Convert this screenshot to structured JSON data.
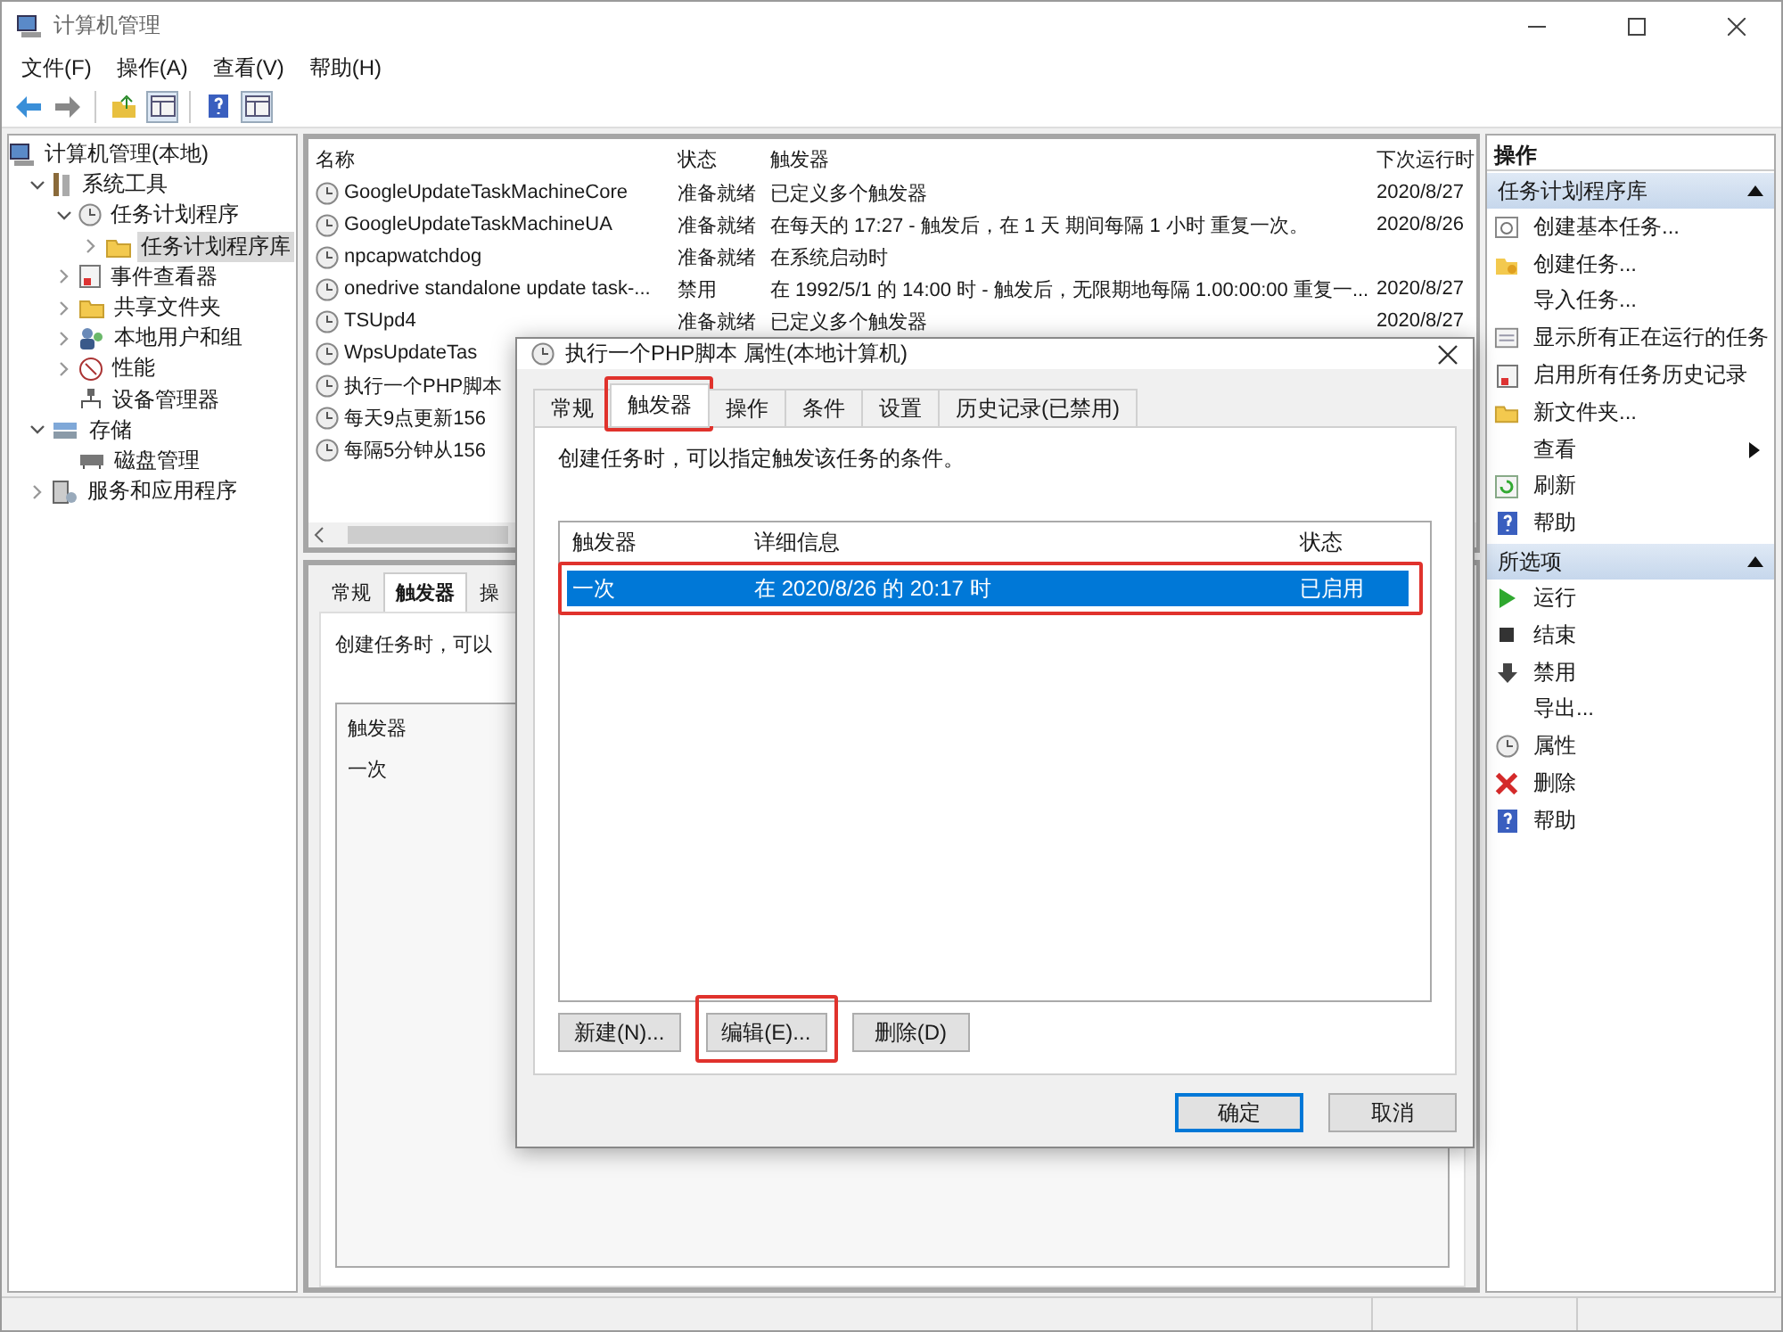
{
  "window": {
    "title": "计算机管理"
  },
  "menu": [
    "文件(F)",
    "操作(A)",
    "查看(V)",
    "帮助(H)"
  ],
  "tree": [
    {
      "label": "计算机管理(本地)",
      "selected": false,
      "children": [
        {
          "label": "系统工具",
          "expanded": true,
          "selected": false,
          "children": [
            {
              "label": "任务计划程序",
              "expanded": true,
              "selected": false,
              "children": [
                {
                  "label": "任务计划程序库",
                  "expanded": false,
                  "selected": true
                }
              ]
            },
            {
              "label": "事件查看器",
              "expanded": false,
              "selected": false
            },
            {
              "label": "共享文件夹",
              "expanded": false,
              "selected": false
            },
            {
              "label": "本地用户和组",
              "expanded": false,
              "selected": false
            },
            {
              "label": "性能",
              "expanded": false,
              "selected": false
            },
            {
              "label": "设备管理器",
              "selected": false
            }
          ]
        },
        {
          "label": "存储",
          "expanded": true,
          "selected": false,
          "children": [
            {
              "label": "磁盘管理",
              "selected": false
            }
          ]
        },
        {
          "label": "服务和应用程序",
          "expanded": false,
          "selected": false
        }
      ]
    }
  ],
  "task_list": {
    "columns": [
      "名称",
      "状态",
      "触发器",
      "下次运行时"
    ],
    "rows": [
      {
        "cells": [
          "GoogleUpdateTaskMachineCore",
          "准备就绪",
          "已定义多个触发器",
          "2020/8/27"
        ]
      },
      {
        "cells": [
          "GoogleUpdateTaskMachineUA",
          "准备就绪",
          "在每天的 17:27 - 触发后，在 1 天 期间每隔 1 小时 重复一次。",
          "2020/8/26"
        ]
      },
      {
        "cells": [
          "npcapwatchdog",
          "准备就绪",
          "在系统启动时"
        ]
      },
      {
        "cells": [
          "onedrive standalone update task-...",
          "禁用",
          "在 1992/5/1 的 14:00 时 - 触发后，无限期地每隔 1.00:00:00 重复一...",
          "2020/8/27"
        ]
      },
      {
        "cells": [
          "TSUpd4",
          "准备就绪",
          "已定义多个触发器",
          "2020/8/27"
        ]
      },
      {
        "cells": [
          "WpsUpdateTas"
        ]
      },
      {
        "cells": [
          "执行一个PHP脚本"
        ]
      },
      {
        "cells": [
          "每天9点更新156"
        ]
      },
      {
        "cells": [
          "每隔5分钟从156"
        ]
      }
    ]
  },
  "detail_pane": {
    "tabs": [
      {
        "label": "常规",
        "selected": false
      },
      {
        "label": "触发器",
        "selected": true
      },
      {
        "label": "操",
        "selected": false
      }
    ],
    "description": "创建任务时，可以",
    "trigger_list": {
      "column": "触发器",
      "rows": [
        "一次"
      ]
    }
  },
  "dialog": {
    "title": "执行一个PHP脚本 属性(本地计算机)",
    "tabs": [
      {
        "label": "常规",
        "selected": false,
        "highlighted": false
      },
      {
        "label": "触发器",
        "selected": true,
        "highlighted": true
      },
      {
        "label": "操作",
        "selected": false,
        "highlighted": false
      },
      {
        "label": "条件",
        "selected": false,
        "highlighted": false
      },
      {
        "label": "设置",
        "selected": false,
        "highlighted": false
      },
      {
        "label": "历史记录(已禁用)",
        "selected": false,
        "highlighted": false
      }
    ],
    "description": "创建任务时，可以指定触发该任务的条件。",
    "trigger_table": {
      "columns": [
        "触发器",
        "详细信息",
        "状态"
      ],
      "rows": [
        {
          "cells": [
            "一次",
            "在 2020/8/26 的 20:17 时",
            "已启用"
          ],
          "selected": true,
          "highlighted": true
        }
      ]
    },
    "buttons": [
      {
        "label": "新建(N)...",
        "highlighted": false
      },
      {
        "label": "编辑(E)...",
        "highlighted": true
      },
      {
        "label": "删除(D)",
        "highlighted": false
      }
    ],
    "footer_buttons": [
      {
        "label": "确定",
        "default": true
      },
      {
        "label": "取消",
        "default": false
      }
    ]
  },
  "actions": {
    "header": "操作",
    "sections": [
      {
        "title": "任务计划程序库",
        "expanded": true,
        "items": [
          {
            "label": "创建基本任务...",
            "submenu": false
          },
          {
            "label": "创建任务...",
            "submenu": false
          },
          {
            "label": "导入任务...",
            "submenu": false
          },
          {
            "label": "显示所有正在运行的任务",
            "submenu": false
          },
          {
            "label": "启用所有任务历史记录",
            "submenu": false
          },
          {
            "label": "新文件夹...",
            "submenu": false
          },
          {
            "label": "查看",
            "submenu": true
          },
          {
            "label": "刷新",
            "submenu": false
          },
          {
            "label": "帮助",
            "submenu": false
          }
        ]
      },
      {
        "title": "所选项",
        "expanded": true,
        "items": [
          {
            "label": "运行",
            "submenu": false
          },
          {
            "label": "结束",
            "submenu": false
          },
          {
            "label": "禁用",
            "submenu": false
          },
          {
            "label": "导出...",
            "submenu": false
          },
          {
            "label": "属性",
            "submenu": false
          },
          {
            "label": "删除",
            "submenu": false
          },
          {
            "label": "帮助",
            "submenu": false
          }
        ]
      }
    ]
  }
}
